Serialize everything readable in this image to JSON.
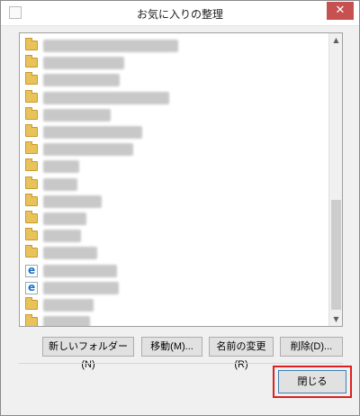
{
  "window": {
    "title": "お気に入りの整理",
    "close_glyph": "✕"
  },
  "list": {
    "rows": [
      {
        "icon": "folder-icon",
        "label": "▒▒▒▒▒▒▒▒▒▒▒▒▒▒▒▒",
        "selected": false
      },
      {
        "icon": "folder-icon",
        "label": "▒▒▒▒▒▒▒▒▒▒",
        "selected": false
      },
      {
        "icon": "folder-icon",
        "label": "▒▒▒▒▒▒▒▒▒▒",
        "selected": false
      },
      {
        "icon": "folder-icon",
        "label": "▒▒▒▒▒▒▒▒▒▒▒▒▒▒",
        "selected": false
      },
      {
        "icon": "folder-icon",
        "label": "▒▒▒▒▒▒▒▒▒",
        "selected": false
      },
      {
        "icon": "folder-icon",
        "label": "▒▒▒▒▒▒▒▒▒▒▒▒",
        "selected": false
      },
      {
        "icon": "folder-icon",
        "label": "▒▒▒▒▒▒▒▒▒▒▒",
        "selected": false
      },
      {
        "icon": "folder-icon",
        "label": "▒▒▒▒",
        "selected": false
      },
      {
        "icon": "folder-icon",
        "label": "▒▒▒▒",
        "selected": false
      },
      {
        "icon": "folder-icon",
        "label": "▒▒▒▒▒▒▒",
        "selected": false
      },
      {
        "icon": "folder-icon",
        "label": "▒▒▒▒▒",
        "selected": false
      },
      {
        "icon": "folder-icon",
        "label": "▒▒▒▒",
        "selected": false
      },
      {
        "icon": "folder-icon",
        "label": "▒▒▒▒▒▒▒",
        "selected": false
      },
      {
        "icon": "ie-page-icon",
        "label": "▒▒▒▒▒▒▒▒",
        "selected": false
      },
      {
        "icon": "ie-page-icon",
        "label": "▒▒▒▒▒▒▒▒▒",
        "selected": false
      },
      {
        "icon": "folder-icon",
        "label": "▒▒▒▒▒▒",
        "selected": false
      },
      {
        "icon": "folder-icon",
        "label": "▒▒▒▒▒",
        "selected": false
      },
      {
        "icon": "link-folder-icon",
        "label": "▒▒",
        "selected": true
      }
    ]
  },
  "scrollbar": {
    "up_glyph": "▲",
    "down_glyph": "▼"
  },
  "buttons": {
    "new_folder": "新しいフォルダー(N)",
    "move": "移動(M)...",
    "rename": "名前の変更(R)",
    "delete": "削除(D)...",
    "close": "閉じる"
  }
}
